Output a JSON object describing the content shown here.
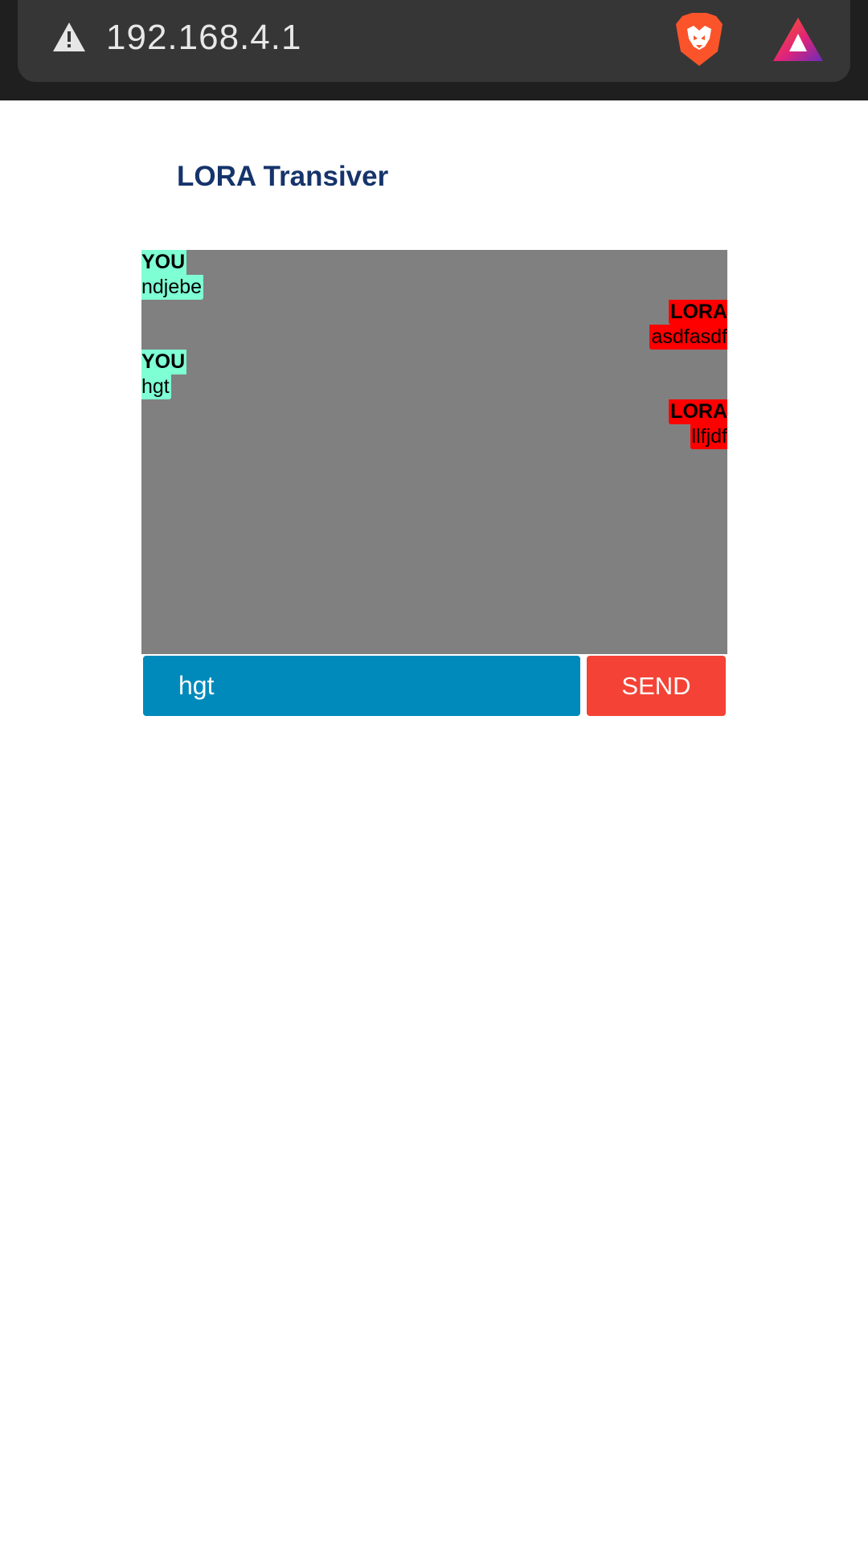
{
  "browser": {
    "url": "192.168.4.1",
    "icons": {
      "security": "warning-triangle-icon",
      "brave": "brave-lion-icon",
      "rewards": "brave-rewards-icon"
    }
  },
  "page": {
    "title": "LORA Transiver"
  },
  "chat": {
    "messages": [
      {
        "sender": "YOU",
        "text": "ndjebe",
        "side": "left"
      },
      {
        "sender": "LORA",
        "text": "asdfasdf",
        "side": "right"
      },
      {
        "sender": "YOU",
        "text": "hgt",
        "side": "left"
      },
      {
        "sender": "LORA",
        "text": "llfjdf",
        "side": "right"
      }
    ]
  },
  "composer": {
    "input_value": "hgt",
    "send_label": "SEND"
  },
  "colors": {
    "chat_background": "#808080",
    "you_bubble": "#7fffd4",
    "lora_bubble": "#ff0000",
    "input_background": "#008abb",
    "send_button": "#f44336",
    "title": "#16346b"
  }
}
